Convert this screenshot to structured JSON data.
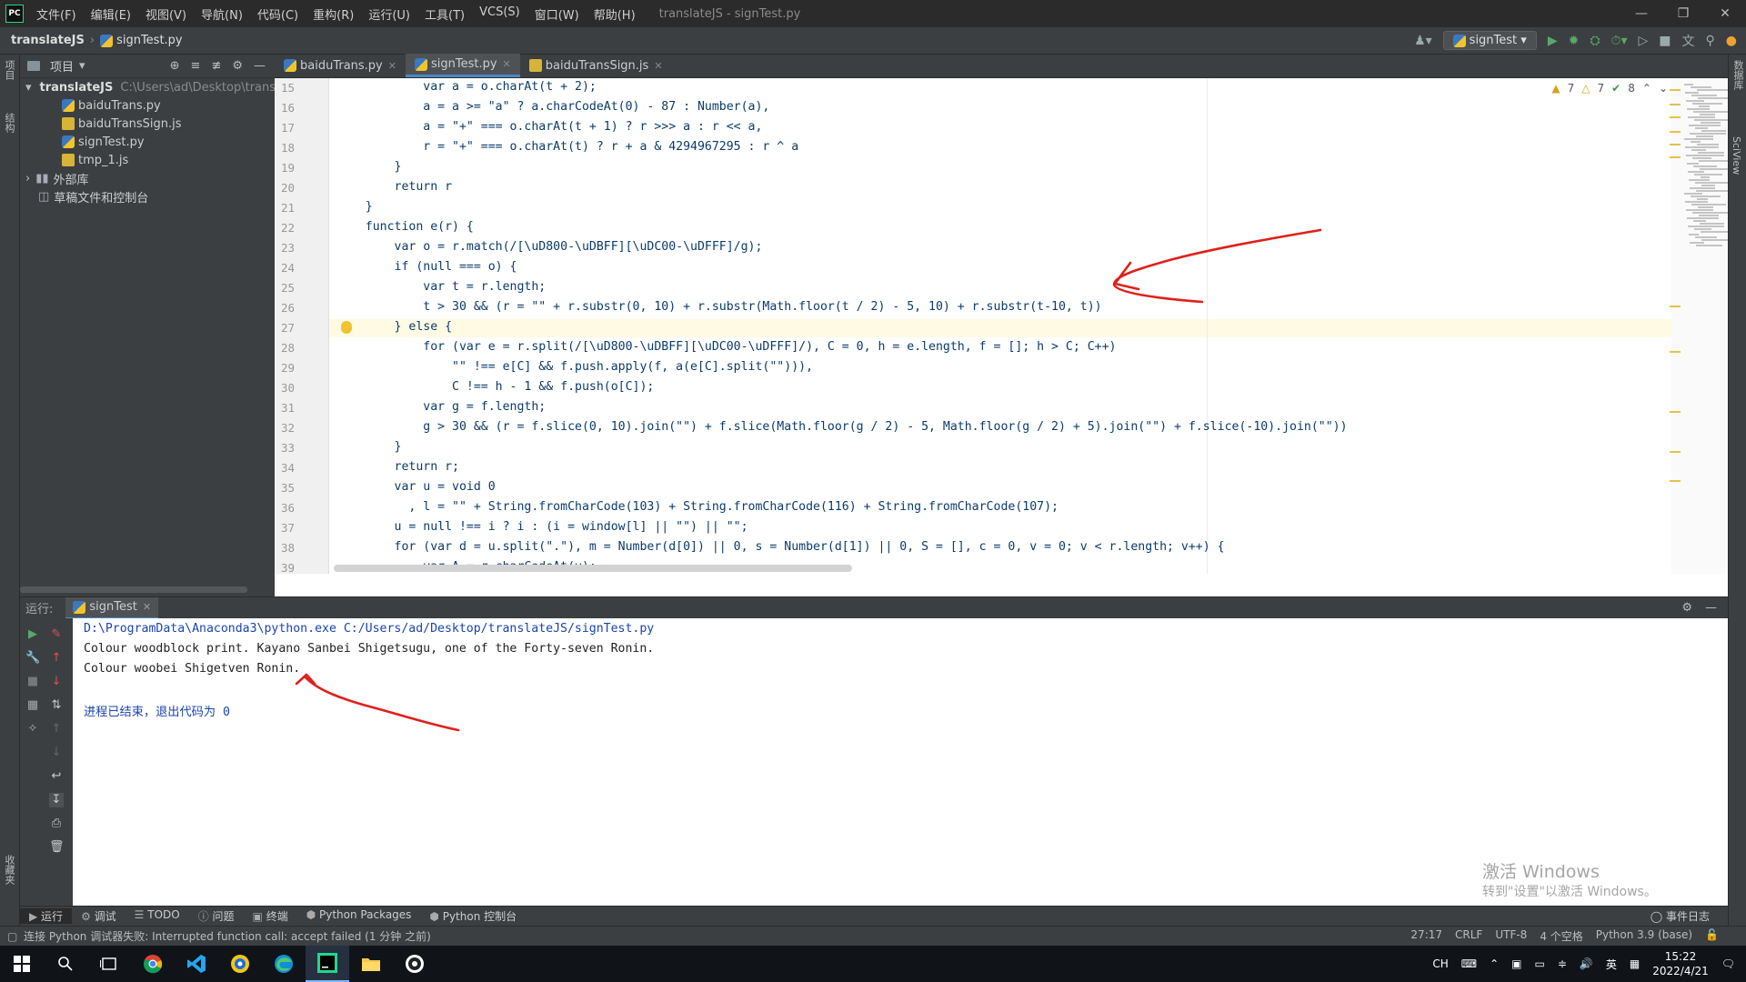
{
  "window": {
    "title": "translateJS - signTest.py",
    "logo_text": "PC",
    "menus": [
      "文件(F)",
      "编辑(E)",
      "视图(V)",
      "导航(N)",
      "代码(C)",
      "重构(R)",
      "运行(U)",
      "工具(T)",
      "VCS(S)",
      "窗口(W)",
      "帮助(H)"
    ]
  },
  "navbar": {
    "project": "translateJS",
    "file": "signTest.py",
    "run_config": "signTest"
  },
  "side_tabs": {
    "left_top": "项目",
    "left_mid": "结构",
    "left_bottom": "收藏夹",
    "right_top": "数据库",
    "right_mid": "SciView"
  },
  "project": {
    "header": "项目",
    "root_name": "translateJS",
    "root_path": "C:\\Users\\ad\\Desktop\\translateJS",
    "files": [
      {
        "name": "baiduTrans.py",
        "type": "py"
      },
      {
        "name": "baiduTransSign.js",
        "type": "js"
      },
      {
        "name": "signTest.py",
        "type": "py"
      },
      {
        "name": "tmp_1.js",
        "type": "js"
      }
    ],
    "external_libs": "外部库",
    "scratches": "草稿文件和控制台"
  },
  "editor_tabs": [
    {
      "name": "baiduTrans.py",
      "type": "py",
      "active": false
    },
    {
      "name": "signTest.py",
      "type": "py",
      "active": true
    },
    {
      "name": "baiduTransSign.js",
      "type": "js",
      "active": false
    }
  ],
  "inspections": {
    "warnings_a": "7",
    "warnings_b": "7",
    "ok": "8"
  },
  "code_lines": [
    {
      "n": "15",
      "text": "            var a = o.charAt(t + 2);"
    },
    {
      "n": "16",
      "text": "            a = a >= \"a\" ? a.charCodeAt(0) - 87 : Number(a),"
    },
    {
      "n": "17",
      "text": "            a = \"+\" === o.charAt(t + 1) ? r >>> a : r << a,"
    },
    {
      "n": "18",
      "text": "            r = \"+\" === o.charAt(t) ? r + a & 4294967295 : r ^ a"
    },
    {
      "n": "19",
      "text": "        }"
    },
    {
      "n": "20",
      "text": "        return r"
    },
    {
      "n": "21",
      "text": "    }"
    },
    {
      "n": "22",
      "text": "    function e(r) {"
    },
    {
      "n": "23",
      "text": "        var o = r.match(/[\\uD800-\\uDBFF][\\uDC00-\\uDFFF]/g);"
    },
    {
      "n": "24",
      "text": "        if (null === o) {"
    },
    {
      "n": "25",
      "text": "            var t = r.length;"
    },
    {
      "n": "26",
      "text": "            t > 30 && (r = \"\" + r.substr(0, 10) + r.substr(Math.floor(t / 2) - 5, 10) + r.substr(t-10, t))"
    },
    {
      "n": "27",
      "text": "        } else {"
    },
    {
      "n": "28",
      "text": "            for (var e = r.split(/[\\uD800-\\uDBFF][\\uDC00-\\uDFFF]/), C = 0, h = e.length, f = []; h > C; C++)"
    },
    {
      "n": "29",
      "text": "                \"\" !== e[C] && f.push.apply(f, a(e[C].split(\"\"))),"
    },
    {
      "n": "30",
      "text": "                C !== h - 1 && f.push(o[C]);"
    },
    {
      "n": "31",
      "text": "            var g = f.length;"
    },
    {
      "n": "32",
      "text": "            g > 30 && (r = f.slice(0, 10).join(\"\") + f.slice(Math.floor(g / 2) - 5, Math.floor(g / 2) + 5).join(\"\") + f.slice(-10).join(\"\"))"
    },
    {
      "n": "33",
      "text": "        }"
    },
    {
      "n": "34",
      "text": "        return r;"
    },
    {
      "n": "35",
      "text": "        var u = void 0"
    },
    {
      "n": "36",
      "text": "          , l = \"\" + String.fromCharCode(103) + String.fromCharCode(116) + String.fromCharCode(107);"
    },
    {
      "n": "37",
      "text": "        u = null !== i ? i : (i = window[l] || \"\") || \"\";"
    },
    {
      "n": "38",
      "text": "        for (var d = u.split(\".\"), m = Number(d[0]) || 0, s = Number(d[1]) || 0, S = [], c = 0, v = 0; v < r.length; v++) {"
    },
    {
      "n": "39",
      "text": "            var A = r.charCodeAt(v);"
    }
  ],
  "run_panel": {
    "label": "运行:",
    "tab": "signTest",
    "console": [
      {
        "text": "D:\\ProgramData\\Anaconda3\\python.exe C:/Users/ad/Desktop/translateJS/signTest.py",
        "color": "#1a44b0"
      },
      {
        "text": "Colour woodblock print. Kayano Sanbei Shigetsugu, one of the Forty-seven Ronin.",
        "color": "#222222"
      },
      {
        "text": "Colour woobei Shigetven Ronin.",
        "color": "#222222"
      },
      {
        "text": "",
        "color": "#222222"
      },
      {
        "text": "进程已结束，退出代码为 0",
        "color": "#1a44b0"
      }
    ]
  },
  "watermark": {
    "line1": "激活 Windows",
    "line2": "转到\"设置\"以激活 Windows。"
  },
  "tool_tabs": [
    "运行",
    "调试",
    "TODO",
    "问题",
    "终端",
    "Python Packages",
    "Python 控制台"
  ],
  "event_log": "事件日志",
  "status": {
    "message": "连接 Python 调试器失败: Interrupted function call: accept failed (1 分钟 之前)",
    "caret": "27:17",
    "line_sep": "CRLF",
    "encoding": "UTF-8",
    "indent": "4 个空格",
    "interpreter": "Python 3.9 (base)"
  },
  "taskbar": {
    "ime1": "CH",
    "ime2": "英",
    "time": "15:22",
    "date": "2022/4/21"
  },
  "colors": {
    "accent": "#4a88c7",
    "annotation_red": "#e0201b",
    "caret_line": "#fffae3"
  }
}
